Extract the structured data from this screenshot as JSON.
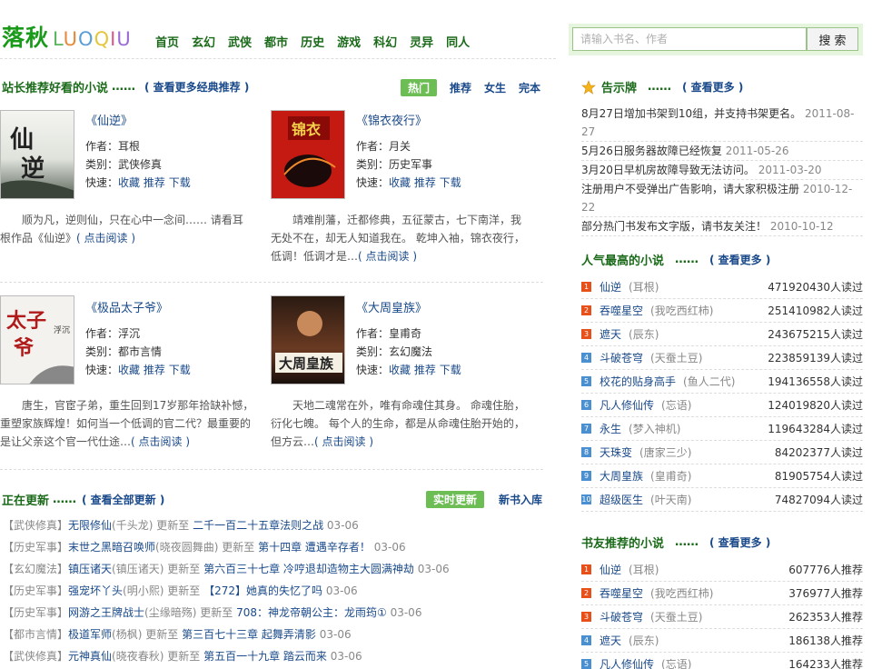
{
  "logo": {
    "cn": "落秋",
    "en": [
      {
        "ch": "L",
        "color": "#5ab55a"
      },
      {
        "ch": "U",
        "color": "#e58a3a"
      },
      {
        "ch": "O",
        "color": "#5a9ed5"
      },
      {
        "ch": "Q",
        "color": "#e5c53a"
      },
      {
        "ch": "I",
        "color": "#d55a8a"
      },
      {
        "ch": "U",
        "color": "#9a6ad5"
      }
    ]
  },
  "nav": [
    "首页",
    "玄幻",
    "武侠",
    "都市",
    "历史",
    "游戏",
    "科幻",
    "灵异",
    "同人"
  ],
  "search": {
    "placeholder": "请输入书名、作者",
    "button": "搜 索"
  },
  "recommend": {
    "title": "站长推荐好看的小说",
    "dots": "……",
    "more": "( 查看更多经典推荐 )",
    "tabs": [
      "热门",
      "推荐",
      "女生",
      "完本"
    ],
    "books": [
      {
        "title": "《仙逆》",
        "author_label": "作者：",
        "author": "耳根",
        "cat_label": "类别：",
        "cat": "武侠修真",
        "quick_label": "快速：",
        "q1": "收藏",
        "q2": "推荐",
        "q3": "下载",
        "intro": "顺为凡，逆则仙，只在心中一念间…… 请看耳根作品《仙逆》",
        "read": "( 点击阅读 )"
      },
      {
        "title": "《锦衣夜行》",
        "author_label": "作者：",
        "author": "月关",
        "cat_label": "类别：",
        "cat": "历史军事",
        "quick_label": "快速：",
        "q1": "收藏",
        "q2": "推荐",
        "q3": "下载",
        "intro": "靖难削藩，迁都修典，五征蒙古，七下南洋，我无处不在，却无人知道我在。 乾坤入袖，锦衣夜行，低调！低调才是…",
        "read": "( 点击阅读 )"
      },
      {
        "title": "《极品太子爷》",
        "author_label": "作者：",
        "author": "浮沉",
        "cat_label": "类别：",
        "cat": "都市言情",
        "quick_label": "快速：",
        "q1": "收藏",
        "q2": "推荐",
        "q3": "下载",
        "intro": "唐生，官宦子弟，重生回到17岁那年拾缺补憾，重塑家族辉煌！如何当一个低调的官二代？最重要的是让父亲这个官一代仕途…",
        "read": "( 点击阅读 )"
      },
      {
        "title": "《大周皇族》",
        "author_label": "作者：",
        "author": "皇甫奇",
        "cat_label": "类别：",
        "cat": "玄幻魔法",
        "quick_label": "快速：",
        "q1": "收藏",
        "q2": "推荐",
        "q3": "下载",
        "intro": "天地二魂常在外，唯有命魂住其身。 命魂住胎，衍化七魄。 每个人的生命，都是从命魂住胎开始的，但方云…",
        "read": "( 点击阅读 )"
      }
    ]
  },
  "updates": {
    "title": "正在更新",
    "dots": "……",
    "more": "( 查看全部更新 )",
    "tab_active": "实时更新",
    "tab": "新书入库",
    "rows": [
      {
        "cat": "【武侠修真】",
        "book": "无限修仙",
        "author": "(千头龙)",
        "mid": "更新至",
        "chapter": "二千一百二十五章法则之战",
        "date": "03-06"
      },
      {
        "cat": "【历史军事】",
        "book": "末世之黑暗召唤师",
        "author": "(晓夜圆舞曲)",
        "mid": "更新至",
        "chapter": "第十四章 遭遇辛存者！",
        "date": "03-06"
      },
      {
        "cat": "【玄幻魔法】",
        "book": "镇压诸天",
        "author": "(镇压诸天)",
        "mid": "更新至",
        "chapter": "第六百三十七章 冷哼退却造物主大圆满神劫",
        "date": "03-06"
      },
      {
        "cat": "【历史军事】",
        "book": "强宠坏丫头",
        "author": "(明小熙)",
        "mid": "更新至",
        "chapter": "【272】她真的失忆了吗",
        "date": "03-06"
      },
      {
        "cat": "【历史军事】",
        "book": "网游之王牌战士",
        "author": "(尘缘暗殇)",
        "mid": "更新至",
        "chapter": "708：神龙帝朝公主：龙雨筠①",
        "date": "03-06"
      },
      {
        "cat": "【都市言情】",
        "book": "极道军师",
        "author": "(杨枫)",
        "mid": "更新至",
        "chapter": "第三百七十三章 起舞弄清影",
        "date": "03-06"
      },
      {
        "cat": "【武侠修真】",
        "book": "元神真仙",
        "author": "(晓夜春秋)",
        "mid": "更新至",
        "chapter": "第五百一十九章 踏云而来",
        "date": "03-06"
      }
    ]
  },
  "notices": {
    "title": "告示牌",
    "dots": "……",
    "more": "( 查看更多 )",
    "items": [
      {
        "text": "8月27日增加书架到10组，并支持书架更名。",
        "date": "2011-08-27"
      },
      {
        "text": "5月26日服务器故障已经恢复",
        "date": "2011-05-26"
      },
      {
        "text": "3月20日早机房故障导致无法访问。",
        "date": "2011-03-20"
      },
      {
        "text": "注册用户不受弹出广告影响，请大家积极注册",
        "date": "2010-12-22"
      },
      {
        "text": "部分热门书发布文字版，请书友关注！",
        "date": "2010-10-12"
      }
    ]
  },
  "popular": {
    "title": "人气最高的小说",
    "dots": "……",
    "more": "( 查看更多 )",
    "items": [
      {
        "n": "1",
        "t": "仙逆",
        "a": "(耳根)",
        "c": "471920430人读过"
      },
      {
        "n": "2",
        "t": "吞噬星空",
        "a": "(我吃西红柿)",
        "c": "251410982人读过"
      },
      {
        "n": "3",
        "t": "遮天",
        "a": "(辰东)",
        "c": "243675215人读过"
      },
      {
        "n": "4",
        "t": "斗破苍穹",
        "a": "(天蚕土豆)",
        "c": "223859139人读过"
      },
      {
        "n": "5",
        "t": "校花的贴身高手",
        "a": "(鱼人二代)",
        "c": "194136558人读过"
      },
      {
        "n": "6",
        "t": "凡人修仙传",
        "a": "(忘语)",
        "c": "124019820人读过"
      },
      {
        "n": "7",
        "t": "永生",
        "a": "(梦入神机)",
        "c": "119643284人读过"
      },
      {
        "n": "8",
        "t": "天珠变",
        "a": "(唐家三少)",
        "c": "84202377人读过"
      },
      {
        "n": "9",
        "t": "大周皇族",
        "a": "(皇甫奇)",
        "c": "81905754人读过"
      },
      {
        "n": "10",
        "t": "超级医生",
        "a": "(叶天南)",
        "c": "74827094人读过"
      }
    ]
  },
  "friends": {
    "title": "书友推荐的小说",
    "dots": "……",
    "more": "( 查看更多 )",
    "items": [
      {
        "n": "1",
        "t": "仙逆",
        "a": "(耳根)",
        "c": "607776人推荐"
      },
      {
        "n": "2",
        "t": "吞噬星空",
        "a": "(我吃西红柿)",
        "c": "376977人推荐"
      },
      {
        "n": "3",
        "t": "斗破苍穹",
        "a": "(天蚕土豆)",
        "c": "262353人推荐"
      },
      {
        "n": "4",
        "t": "遮天",
        "a": "(辰东)",
        "c": "186138人推荐"
      },
      {
        "n": "5",
        "t": "凡人修仙传",
        "a": "(忘语)",
        "c": "164233人推荐"
      }
    ]
  },
  "colors": {
    "green": "#1a6a1a",
    "link": "#1a4a8a",
    "tab_bg": "#6cbd54",
    "rank_top": "#e8501a",
    "rank_other": "#4a90d0"
  }
}
